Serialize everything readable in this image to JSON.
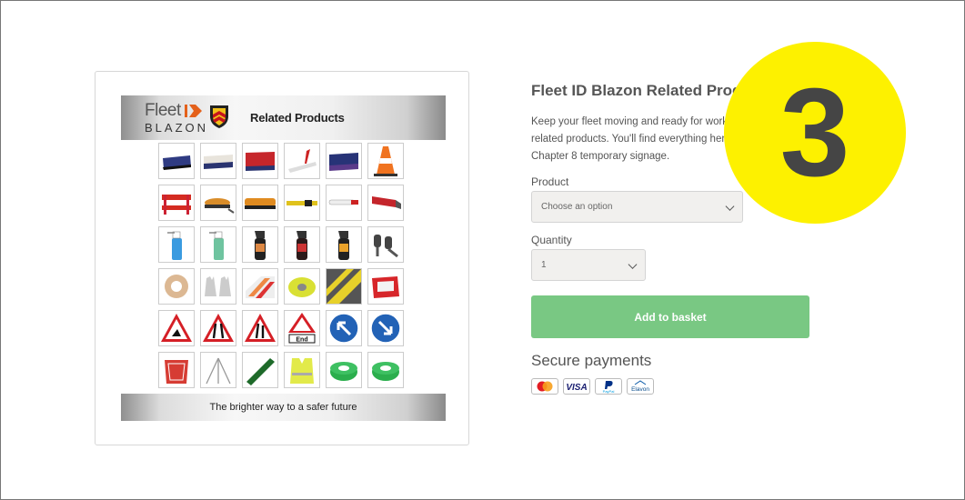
{
  "product_image": {
    "brand_top": "Fleet",
    "brand_bottom": "BLAZON",
    "banner_title": "Related Products",
    "footer_tagline": "The brighter way to a safer future",
    "end_sign_text": "End"
  },
  "product": {
    "title": "Fleet ID Blazon Related Produc",
    "description_lines": [
      "Keep your fleet moving and ready for work",
      "related products. You'll find everything her",
      "Chapter 8 temporary signage."
    ]
  },
  "form": {
    "product_label": "Product",
    "product_select_value": "Choose an option",
    "quantity_label": "Quantity",
    "quantity_value": "1",
    "add_button_label": "Add to basket"
  },
  "payments": {
    "heading": "Secure payments",
    "methods": [
      "Mastercard",
      "VISA",
      "PayPal",
      "Elavon"
    ],
    "visa_text": "VISA",
    "paypal_text": "PayPal",
    "elavon_text": "Elavon"
  },
  "step_badge": {
    "number": "3",
    "color": "#fdf100"
  },
  "colors": {
    "add_button": "#79c883",
    "select_bg": "#f1f0ee"
  }
}
